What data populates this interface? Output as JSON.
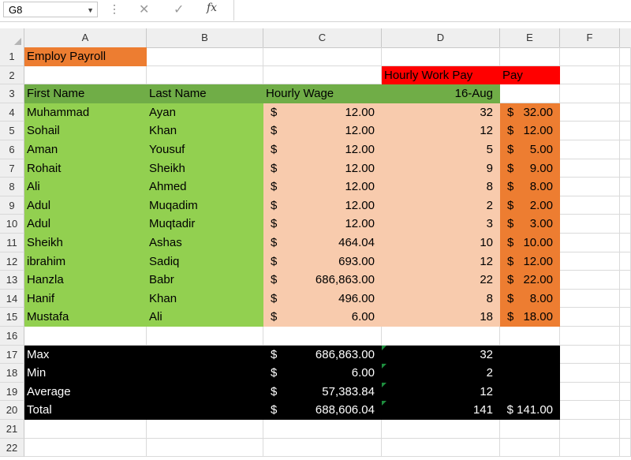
{
  "formula_bar": {
    "name_box": "G8",
    "fx": "fx",
    "cancel": "✕",
    "enter": "✓",
    "more": "⋮",
    "content": ""
  },
  "columns": [
    "A",
    "B",
    "C",
    "D",
    "E",
    "F"
  ],
  "title": "Employ Payroll",
  "headers": {
    "hourly_work_pay": "Hourly Work Pay",
    "pay": "Pay",
    "first_name": "First Name",
    "last_name": "Last Name",
    "hourly_wage": "Hourly Wage",
    "date": "16-Aug"
  },
  "employees": [
    {
      "first": "Muhammad",
      "last": "Ayan",
      "wage": "12.00",
      "hours": "32",
      "pay": "32.00"
    },
    {
      "first": "Sohail",
      "last": "Khan",
      "wage": "12.00",
      "hours": "12",
      "pay": "12.00"
    },
    {
      "first": "Aman",
      "last": "Yousuf",
      "wage": "12.00",
      "hours": "5",
      "pay": "5.00"
    },
    {
      "first": "Rohait",
      "last": "Sheikh",
      "wage": "12.00",
      "hours": "9",
      "pay": "9.00"
    },
    {
      "first": "Ali",
      "last": "Ahmed",
      "wage": "12.00",
      "hours": "8",
      "pay": "8.00"
    },
    {
      "first": "Adul",
      "last": "Muqadim",
      "wage": "12.00",
      "hours": "2",
      "pay": "2.00"
    },
    {
      "first": "Adul",
      "last": "Muqtadir",
      "wage": "12.00",
      "hours": "3",
      "pay": "3.00"
    },
    {
      "first": "Sheikh",
      "last": "Ashas",
      "wage": "464.04",
      "hours": "10",
      "pay": "10.00"
    },
    {
      "first": "ibrahim",
      "last": "Sadiq",
      "wage": "693.00",
      "hours": "12",
      "pay": "12.00"
    },
    {
      "first": "Hanzla",
      "last": "Babr",
      "wage": "686,863.00",
      "hours": "22",
      "pay": "22.00"
    },
    {
      "first": "Hanif",
      "last": "Khan",
      "wage": "496.00",
      "hours": "8",
      "pay": "8.00"
    },
    {
      "first": "Mustafa",
      "last": "Ali",
      "wage": "6.00",
      "hours": "18",
      "pay": "18.00"
    }
  ],
  "summary": [
    {
      "label": "Max",
      "wage": "686,863.00",
      "hours": "32",
      "pay": ""
    },
    {
      "label": "Min",
      "wage": "6.00",
      "hours": "2",
      "pay": ""
    },
    {
      "label": "Average",
      "wage": "57,383.84",
      "hours": "12",
      "pay": ""
    },
    {
      "label": "Total",
      "wage": "688,606.04",
      "hours": "141",
      "pay": "$ 141.00"
    }
  ],
  "currency": "$",
  "colors": {
    "title_bg": "#ed7d31",
    "header_bg": "#70ad47",
    "names_bg": "#92d050",
    "wage_bg": "#f8cbad",
    "pay_bg": "#ed7d31",
    "red_header": "#ff0000",
    "summary_bg": "#000000"
  }
}
